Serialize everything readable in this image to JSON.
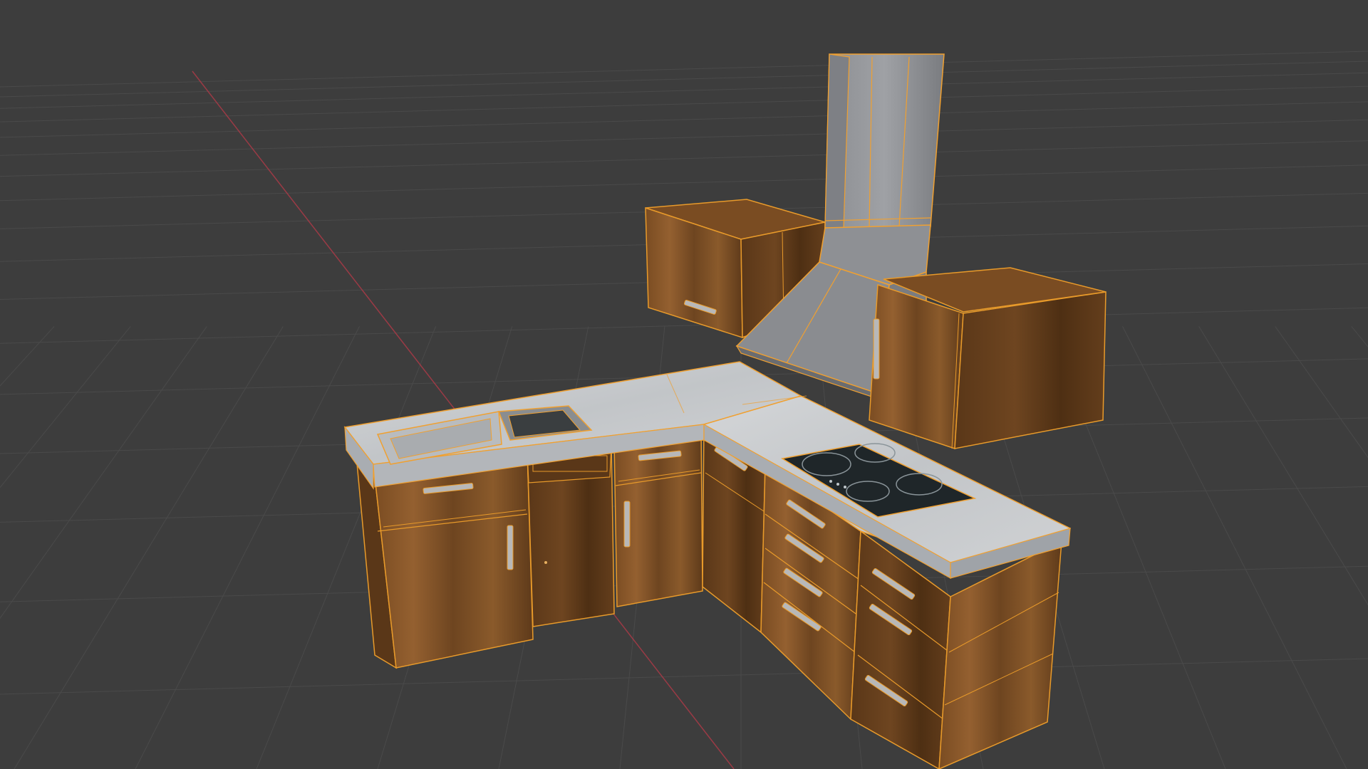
{
  "app": {
    "name": "3D viewport",
    "background": "#3d3d3d"
  },
  "viewport": {
    "grid": true,
    "grid_color": "#4a4a4a",
    "x_axis_color": "#b33a48",
    "selection_outline_color": "#f0a030",
    "wireframe_color": "#d98a1c",
    "objects": [
      {
        "name": "base-cabinets",
        "material": "walnut-wood",
        "selected": true
      },
      {
        "name": "countertop",
        "material": "white-marble",
        "selected": true
      },
      {
        "name": "sink",
        "material": "metal",
        "selected": true
      },
      {
        "name": "dishwasher",
        "material": "walnut-wood",
        "selected": true
      },
      {
        "name": "induction-cooktop",
        "material": "black-glass",
        "selected": true
      },
      {
        "name": "range-hood",
        "material": "steel-grey",
        "selected": true
      },
      {
        "name": "wall-cabinet-left",
        "material": "walnut-wood",
        "selected": true
      },
      {
        "name": "wall-cabinet-right",
        "material": "walnut-wood",
        "selected": true
      }
    ],
    "colors": {
      "wood_light": "#8a5a2b",
      "wood_mid": "#6e4520",
      "wood_dark": "#4a2c12",
      "marble_top": "#c9cccf",
      "marble_edge": "#a9adb2",
      "hood_light": "#9a9ca0",
      "hood_mid": "#7e8085",
      "hood_dark": "#6a6c70",
      "cooktop": "#1f2629",
      "handle": "#b8b8b8"
    }
  }
}
